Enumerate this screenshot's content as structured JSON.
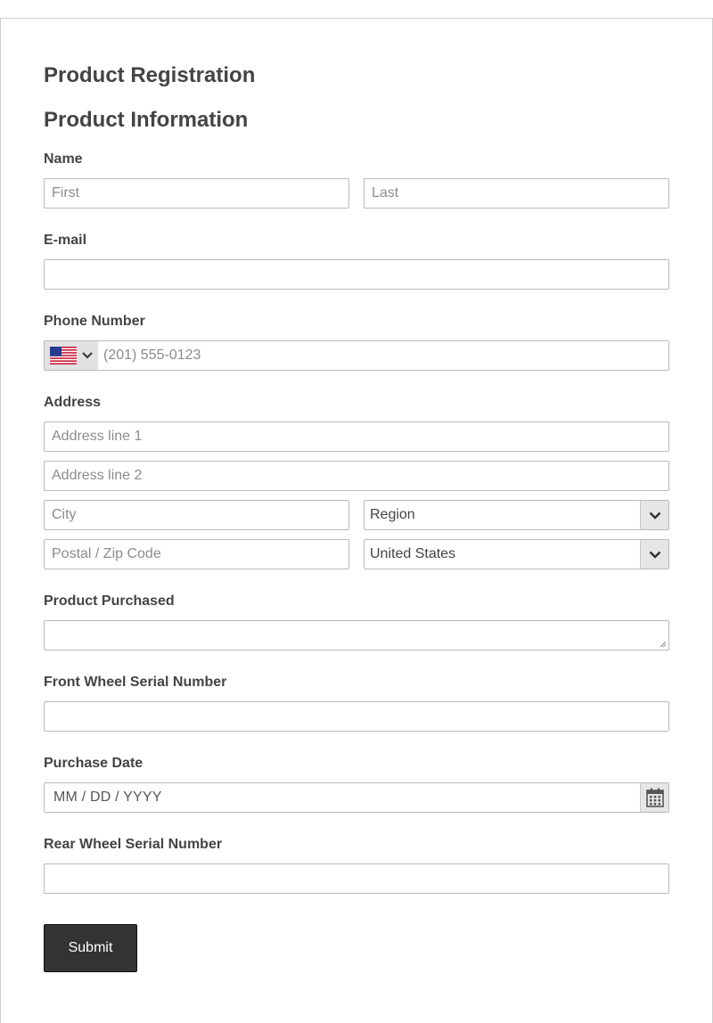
{
  "form": {
    "title": "Product Registration",
    "section_title": "Product Information",
    "submit_label": "Submit"
  },
  "name": {
    "label": "Name",
    "first_placeholder": "First",
    "last_placeholder": "Last"
  },
  "email": {
    "label": "E-mail",
    "value": ""
  },
  "phone": {
    "label": "Phone Number",
    "country_flag": "us-flag-icon",
    "placeholder": "(201) 555-0123"
  },
  "address": {
    "label": "Address",
    "line1_placeholder": "Address line 1",
    "line2_placeholder": "Address line 2",
    "city_placeholder": "City",
    "region_selected": "Region",
    "postal_placeholder": "Postal / Zip Code",
    "country_selected": "United States"
  },
  "product_purchased": {
    "label": "Product Purchased",
    "value": ""
  },
  "front_wheel": {
    "label": "Front Wheel Serial Number",
    "value": ""
  },
  "purchase_date": {
    "label": "Purchase Date",
    "placeholder": "MM / DD / YYYY",
    "icon": "calendar-icon"
  },
  "rear_wheel": {
    "label": "Rear Wheel Serial Number",
    "value": ""
  },
  "colors": {
    "text": "#444444",
    "border": "#b9b9b9",
    "button_bg": "#333333",
    "select_arrow_bg": "#e6e6e6"
  }
}
